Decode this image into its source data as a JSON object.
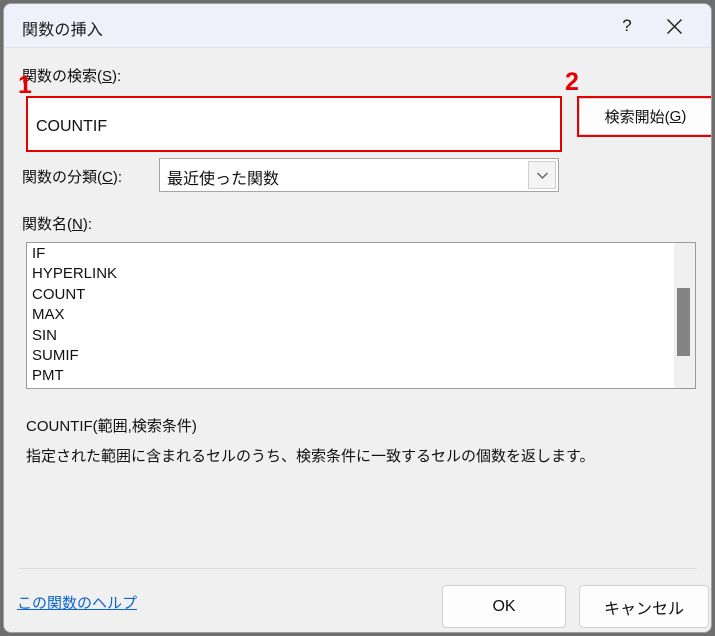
{
  "dialog": {
    "title": "関数の挿入",
    "help_button_icon": "question-mark-icon",
    "close_button_icon": "close-x-icon"
  },
  "search": {
    "label_prefix": "関数の検索(",
    "label_accel": "S",
    "label_suffix": "):",
    "value": "COUNTIF",
    "placeholder": "",
    "button_prefix": "検索開始(",
    "button_accel": "G",
    "button_suffix": ")"
  },
  "category": {
    "label_prefix": "関数の分類(",
    "label_accel": "C",
    "label_suffix": "):",
    "selected": "最近使った関数",
    "arrow_icon": "chevron-down-icon"
  },
  "function_list": {
    "label_prefix": "関数名(",
    "label_accel": "N",
    "label_suffix": "):",
    "items": [
      "IF",
      "HYPERLINK",
      "COUNT",
      "MAX",
      "SIN",
      "SUMIF",
      "PMT"
    ]
  },
  "description": {
    "syntax": "COUNTIF(範囲,検索条件)",
    "text": "指定された範囲に含まれるセルのうち、検索条件に一致するセルの個数を返します。"
  },
  "footer": {
    "help_link": "この関数のヘルプ",
    "ok_label": "OK",
    "cancel_label": "キャンセル"
  },
  "annotations": {
    "marker_1": "1",
    "marker_2": "2",
    "highlight_color": "#e60000"
  }
}
